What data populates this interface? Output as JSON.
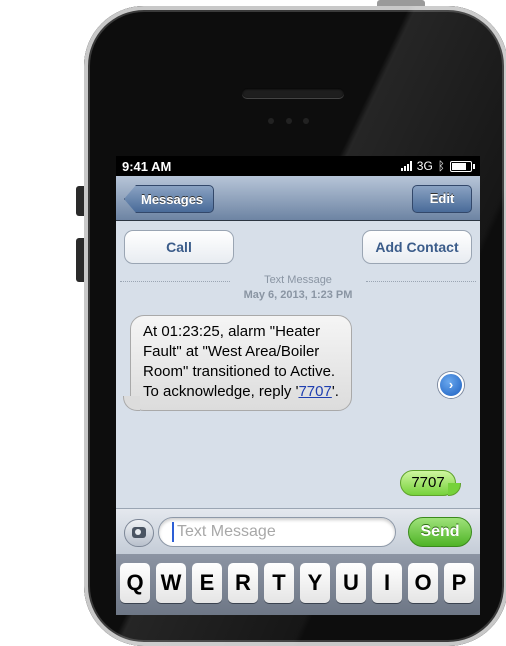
{
  "status": {
    "time": "9:41 AM",
    "network": "3G",
    "signal_bars": 4,
    "battery_level": 0.8
  },
  "nav": {
    "back_label": "Messages",
    "edit_label": "Edit"
  },
  "actions": {
    "call_label": "Call",
    "add_contact_label": "Add Contact"
  },
  "thread": {
    "type_label": "Text Message",
    "date": "May 6, 2013, 1:23 PM",
    "incoming_message": {
      "text": "At 01:23:25, alarm \"Heater Fault\" at \"West Area/Boiler Room\" transitioned to Active.\nTo acknowledge, reply '",
      "code": "7707",
      "suffix": "'."
    },
    "outgoing_message": "7707"
  },
  "composer": {
    "placeholder": "Text Message",
    "send_label": "Send"
  },
  "keyboard": {
    "row1": [
      "Q",
      "W",
      "E",
      "R",
      "T",
      "Y",
      "U",
      "I",
      "O",
      "P"
    ]
  },
  "colors": {
    "incoming_bubble": "#e6e6e6",
    "outgoing_bubble": "#9ee45f",
    "navbar": "#6d84a3",
    "link": "#1f3fb0",
    "send_button": "#4fb426"
  },
  "icons": {
    "disclosure": "chevron-right-icon",
    "camera": "camera-icon",
    "bluetooth": "bluetooth-icon"
  }
}
